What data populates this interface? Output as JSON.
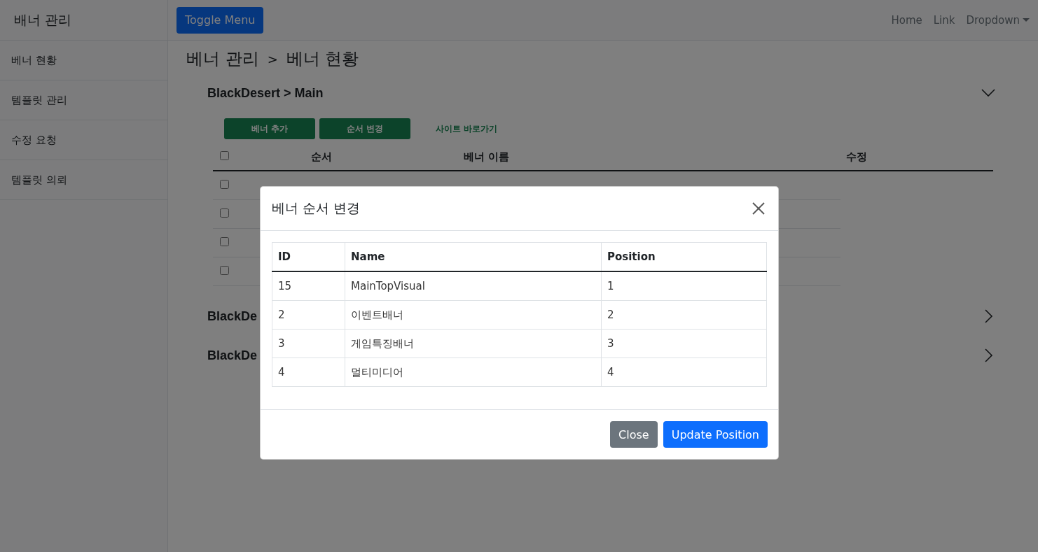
{
  "sidebar": {
    "title": "배너 관리",
    "items": [
      {
        "label": "베너 현황"
      },
      {
        "label": "템플릿 관리"
      },
      {
        "label": "수정 요청"
      },
      {
        "label": "템플릿 의뢰"
      }
    ]
  },
  "navbar": {
    "toggle_button": "Toggle Menu",
    "links": [
      {
        "label": "Home",
        "kind": "link"
      },
      {
        "label": "Link",
        "kind": "link"
      },
      {
        "label": "Dropdown",
        "kind": "dropdown"
      }
    ]
  },
  "breadcrumb": {
    "parts": [
      "베너 관리",
      "베너 현황"
    ],
    "separator": ">"
  },
  "sections": [
    {
      "title": "BlackDesert > Main",
      "expanded": true,
      "buttons": [
        "베너 추가",
        "순서 변경"
      ],
      "site_link": "사이트 바로가기",
      "table": {
        "header_checked": false,
        "columns": [
          "순서",
          "베너 이름",
          "수정"
        ],
        "rows": [
          {
            "checked": false
          },
          {
            "checked": false
          },
          {
            "checked": false
          },
          {
            "checked": false
          }
        ]
      }
    },
    {
      "title": "BlackDe",
      "expanded": false
    },
    {
      "title": "BlackDe",
      "expanded": false
    }
  ],
  "modal": {
    "title": "베너 순서 변경",
    "columns": [
      "ID",
      "Name",
      "Position"
    ],
    "rows": [
      [
        "15",
        "MainTopVisual",
        "1"
      ],
      [
        "2",
        "이벤트배너",
        "2"
      ],
      [
        "3",
        "게임특징배너",
        "3"
      ],
      [
        "4",
        "멀티미디어",
        "4"
      ]
    ],
    "buttons": [
      {
        "label": "Close",
        "kind": "secondary"
      },
      {
        "label": "Update Position",
        "kind": "primary"
      }
    ]
  }
}
